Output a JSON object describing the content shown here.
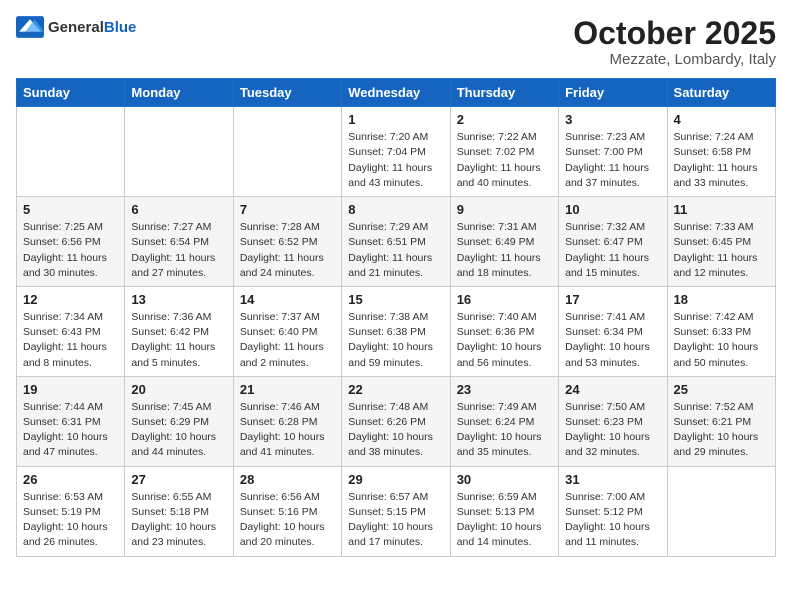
{
  "header": {
    "logo_general": "General",
    "logo_blue": "Blue",
    "month": "October 2025",
    "location": "Mezzate, Lombardy, Italy"
  },
  "weekdays": [
    "Sunday",
    "Monday",
    "Tuesday",
    "Wednesday",
    "Thursday",
    "Friday",
    "Saturday"
  ],
  "rows": [
    [
      {
        "day": "",
        "info": ""
      },
      {
        "day": "",
        "info": ""
      },
      {
        "day": "",
        "info": ""
      },
      {
        "day": "1",
        "info": "Sunrise: 7:20 AM\nSunset: 7:04 PM\nDaylight: 11 hours\nand 43 minutes."
      },
      {
        "day": "2",
        "info": "Sunrise: 7:22 AM\nSunset: 7:02 PM\nDaylight: 11 hours\nand 40 minutes."
      },
      {
        "day": "3",
        "info": "Sunrise: 7:23 AM\nSunset: 7:00 PM\nDaylight: 11 hours\nand 37 minutes."
      },
      {
        "day": "4",
        "info": "Sunrise: 7:24 AM\nSunset: 6:58 PM\nDaylight: 11 hours\nand 33 minutes."
      }
    ],
    [
      {
        "day": "5",
        "info": "Sunrise: 7:25 AM\nSunset: 6:56 PM\nDaylight: 11 hours\nand 30 minutes."
      },
      {
        "day": "6",
        "info": "Sunrise: 7:27 AM\nSunset: 6:54 PM\nDaylight: 11 hours\nand 27 minutes."
      },
      {
        "day": "7",
        "info": "Sunrise: 7:28 AM\nSunset: 6:52 PM\nDaylight: 11 hours\nand 24 minutes."
      },
      {
        "day": "8",
        "info": "Sunrise: 7:29 AM\nSunset: 6:51 PM\nDaylight: 11 hours\nand 21 minutes."
      },
      {
        "day": "9",
        "info": "Sunrise: 7:31 AM\nSunset: 6:49 PM\nDaylight: 11 hours\nand 18 minutes."
      },
      {
        "day": "10",
        "info": "Sunrise: 7:32 AM\nSunset: 6:47 PM\nDaylight: 11 hours\nand 15 minutes."
      },
      {
        "day": "11",
        "info": "Sunrise: 7:33 AM\nSunset: 6:45 PM\nDaylight: 11 hours\nand 12 minutes."
      }
    ],
    [
      {
        "day": "12",
        "info": "Sunrise: 7:34 AM\nSunset: 6:43 PM\nDaylight: 11 hours\nand 8 minutes."
      },
      {
        "day": "13",
        "info": "Sunrise: 7:36 AM\nSunset: 6:42 PM\nDaylight: 11 hours\nand 5 minutes."
      },
      {
        "day": "14",
        "info": "Sunrise: 7:37 AM\nSunset: 6:40 PM\nDaylight: 11 hours\nand 2 minutes."
      },
      {
        "day": "15",
        "info": "Sunrise: 7:38 AM\nSunset: 6:38 PM\nDaylight: 10 hours\nand 59 minutes."
      },
      {
        "day": "16",
        "info": "Sunrise: 7:40 AM\nSunset: 6:36 PM\nDaylight: 10 hours\nand 56 minutes."
      },
      {
        "day": "17",
        "info": "Sunrise: 7:41 AM\nSunset: 6:34 PM\nDaylight: 10 hours\nand 53 minutes."
      },
      {
        "day": "18",
        "info": "Sunrise: 7:42 AM\nSunset: 6:33 PM\nDaylight: 10 hours\nand 50 minutes."
      }
    ],
    [
      {
        "day": "19",
        "info": "Sunrise: 7:44 AM\nSunset: 6:31 PM\nDaylight: 10 hours\nand 47 minutes."
      },
      {
        "day": "20",
        "info": "Sunrise: 7:45 AM\nSunset: 6:29 PM\nDaylight: 10 hours\nand 44 minutes."
      },
      {
        "day": "21",
        "info": "Sunrise: 7:46 AM\nSunset: 6:28 PM\nDaylight: 10 hours\nand 41 minutes."
      },
      {
        "day": "22",
        "info": "Sunrise: 7:48 AM\nSunset: 6:26 PM\nDaylight: 10 hours\nand 38 minutes."
      },
      {
        "day": "23",
        "info": "Sunrise: 7:49 AM\nSunset: 6:24 PM\nDaylight: 10 hours\nand 35 minutes."
      },
      {
        "day": "24",
        "info": "Sunrise: 7:50 AM\nSunset: 6:23 PM\nDaylight: 10 hours\nand 32 minutes."
      },
      {
        "day": "25",
        "info": "Sunrise: 7:52 AM\nSunset: 6:21 PM\nDaylight: 10 hours\nand 29 minutes."
      }
    ],
    [
      {
        "day": "26",
        "info": "Sunrise: 6:53 AM\nSunset: 5:19 PM\nDaylight: 10 hours\nand 26 minutes."
      },
      {
        "day": "27",
        "info": "Sunrise: 6:55 AM\nSunset: 5:18 PM\nDaylight: 10 hours\nand 23 minutes."
      },
      {
        "day": "28",
        "info": "Sunrise: 6:56 AM\nSunset: 5:16 PM\nDaylight: 10 hours\nand 20 minutes."
      },
      {
        "day": "29",
        "info": "Sunrise: 6:57 AM\nSunset: 5:15 PM\nDaylight: 10 hours\nand 17 minutes."
      },
      {
        "day": "30",
        "info": "Sunrise: 6:59 AM\nSunset: 5:13 PM\nDaylight: 10 hours\nand 14 minutes."
      },
      {
        "day": "31",
        "info": "Sunrise: 7:00 AM\nSunset: 5:12 PM\nDaylight: 10 hours\nand 11 minutes."
      },
      {
        "day": "",
        "info": ""
      }
    ]
  ]
}
